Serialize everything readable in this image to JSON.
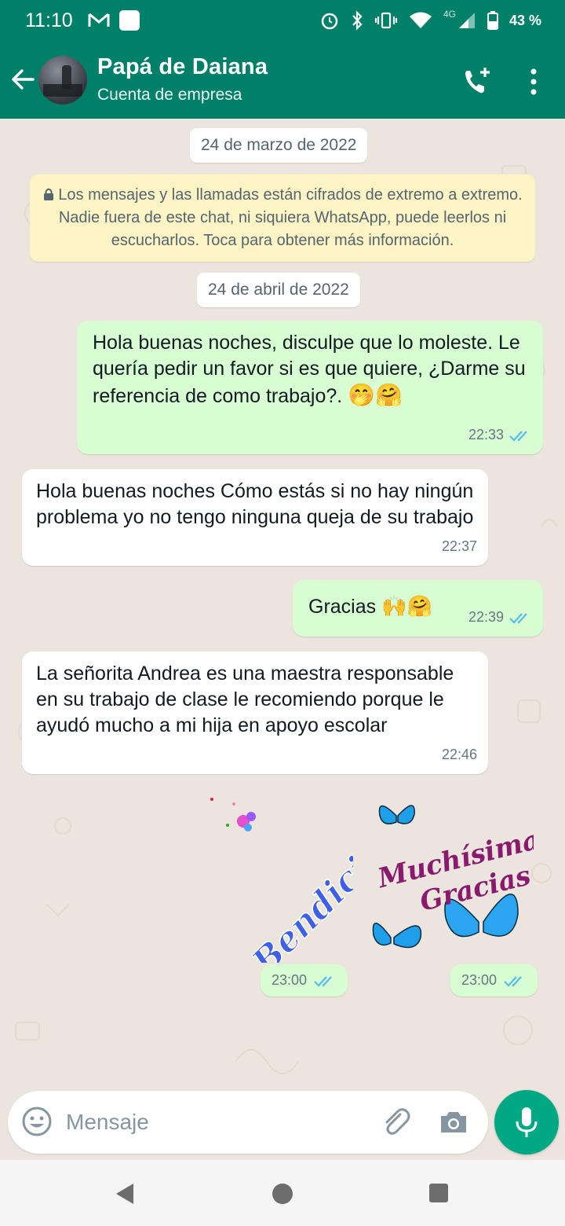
{
  "status_bar": {
    "time": "11:10",
    "network": "4G",
    "battery": "43 %"
  },
  "header": {
    "contact_name": "Papá de Daiana",
    "contact_subtitle": "Cuenta de empresa"
  },
  "chat": {
    "date_1": "24 de marzo de 2022",
    "encryption_notice": "Los mensajes y las llamadas están cifrados de extremo a extremo. Nadie fuera de este chat, ni siquiera WhatsApp, puede leerlos ni escucharlos. Toca para obtener más información.",
    "date_2": "24 de abril de 2022",
    "messages": [
      {
        "direction": "out",
        "text": "Hola buenas noches, disculpe que lo moleste. Le quería pedir un favor si es que quiere, ¿Darme su referencia de como trabajo?.",
        "emoji": "🤭🤗",
        "time": "22:33",
        "status": "read"
      },
      {
        "direction": "in",
        "text": "Hola buenas noches Cómo estás si no hay ningún problema yo no tengo ninguna queja de su trabajo",
        "time": "22:37"
      },
      {
        "direction": "out",
        "text": "Gracias",
        "emoji": "🙌🤗",
        "time": "22:39",
        "status": "read"
      },
      {
        "direction": "in",
        "text": "La señorita Andrea es una maestra responsable en su trabajo de clase le recomiendo porque le ayudó mucho a mi hija en apoyo escolar",
        "time": "22:46"
      }
    ],
    "stickers": [
      {
        "text": "Bendiciones",
        "time": "23:00",
        "status": "read"
      },
      {
        "text_line_1": "Muchísimas",
        "text_line_2": "Gracias",
        "time": "23:00",
        "status": "read"
      }
    ]
  },
  "composer": {
    "placeholder": "Mensaje"
  },
  "icons": {
    "back": "arrow-left-icon",
    "call": "add-call-icon",
    "menu": "more-vertical-icon",
    "emoji": "smiley-icon",
    "attach": "paperclip-icon",
    "camera": "camera-icon",
    "mic": "microphone-icon"
  },
  "colors": {
    "header": "#008069",
    "outgoing_bubble": "#d9fdd3",
    "incoming_bubble": "#ffffff",
    "accent": "#00a884",
    "read_ticks": "#53bdeb"
  }
}
